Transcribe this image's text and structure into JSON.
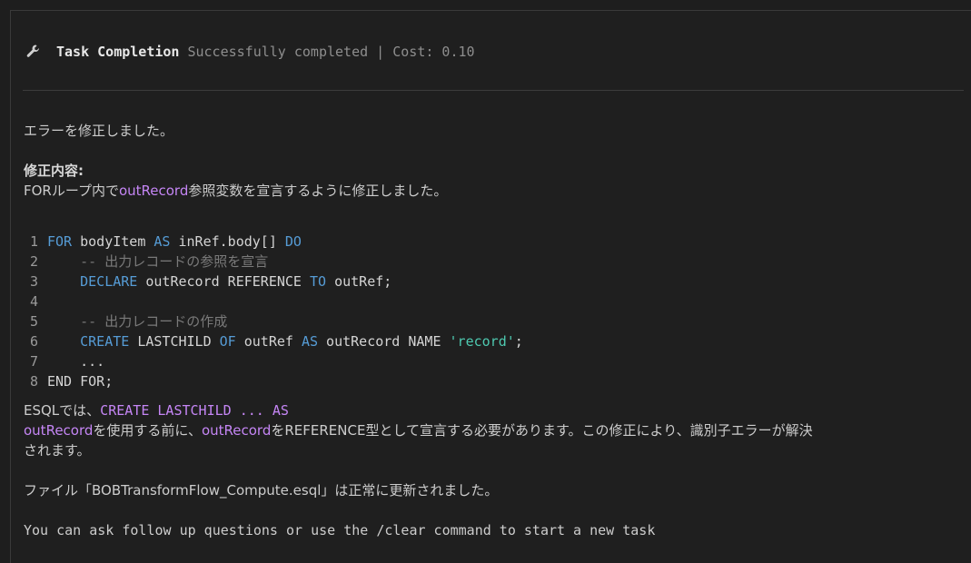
{
  "header": {
    "icon": "wrench-icon",
    "title": "Task Completion",
    "status": "Successfully completed | Cost: 0.10"
  },
  "body": {
    "intro": "エラーを修正しました。",
    "fix_heading": "修正内容:",
    "fix_line_prefix": "FORループ内で",
    "fix_line_var": "outRecord",
    "fix_line_suffix": "参照変数を宣言するように修正しました。",
    "code": [
      {
        "n": "1",
        "tokens": [
          [
            "kw",
            "FOR"
          ],
          [
            "tx",
            " bodyItem "
          ],
          [
            "kw",
            "AS"
          ],
          [
            "tx",
            " inRef.body[] "
          ],
          [
            "kw",
            "DO"
          ]
        ]
      },
      {
        "n": "2",
        "tokens": [
          [
            "tx",
            "    "
          ],
          [
            "cm",
            "-- 出力レコードの参照を宣言"
          ]
        ]
      },
      {
        "n": "3",
        "tokens": [
          [
            "tx",
            "    "
          ],
          [
            "kw",
            "DECLARE"
          ],
          [
            "tx",
            " outRecord REFERENCE "
          ],
          [
            "kw",
            "TO"
          ],
          [
            "tx",
            " outRef;"
          ]
        ]
      },
      {
        "n": "4",
        "tokens": [
          [
            "tx",
            ""
          ]
        ]
      },
      {
        "n": "5",
        "tokens": [
          [
            "tx",
            "    "
          ],
          [
            "cm",
            "-- 出力レコードの作成"
          ]
        ]
      },
      {
        "n": "6",
        "tokens": [
          [
            "tx",
            "    "
          ],
          [
            "kw",
            "CREATE"
          ],
          [
            "tx",
            " LASTCHILD "
          ],
          [
            "kw",
            "OF"
          ],
          [
            "tx",
            " outRef "
          ],
          [
            "kw",
            "AS"
          ],
          [
            "tx",
            " outRecord NAME "
          ],
          [
            "str",
            "'record'"
          ],
          [
            "tx",
            ";"
          ]
        ]
      },
      {
        "n": "7",
        "tokens": [
          [
            "tx",
            "    ..."
          ]
        ]
      },
      {
        "n": "8",
        "tokens": [
          [
            "tx",
            "END FOR;"
          ]
        ]
      }
    ],
    "explain_prefix": "ESQLでは、",
    "explain_code": "CREATE LASTCHILD ... AS",
    "explain_var1": "outRecord",
    "explain_mid1": "を使用する前に、",
    "explain_var2": "outRecord",
    "explain_mid2": "をREFERENCE型として宣言する必要があります。この修正により、識別子エラーが解決",
    "explain_end": "されます。",
    "file_line": "ファイル「BOBTransformFlow_Compute.esql」は正常に更新されました。",
    "footer": "You can ask follow up questions or use the /clear command to start a new task"
  }
}
